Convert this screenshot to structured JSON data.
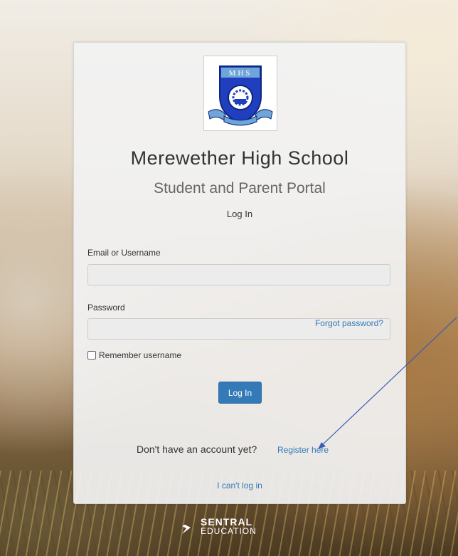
{
  "school": {
    "logo_text": "MHS",
    "name": "Merewether High School",
    "portal": "Student and Parent Portal"
  },
  "form": {
    "heading": "Log In",
    "username_label": "Email or Username",
    "username_value": "",
    "password_label": "Password",
    "password_value": "",
    "remember_label": "Remember username",
    "remember_checked": false,
    "forgot_link": "Forgot password?",
    "submit_label": "Log In",
    "register_prompt": "Don't have an account yet?",
    "register_link": "Register here",
    "cant_login_link": "I can't log in"
  },
  "footer": {
    "brand_line1": "SENTRAL",
    "brand_line2": "EDUCATION"
  },
  "colors": {
    "link": "#337ab7",
    "button": "#337ab7",
    "annotation_arrow": "#3b5bb5"
  }
}
